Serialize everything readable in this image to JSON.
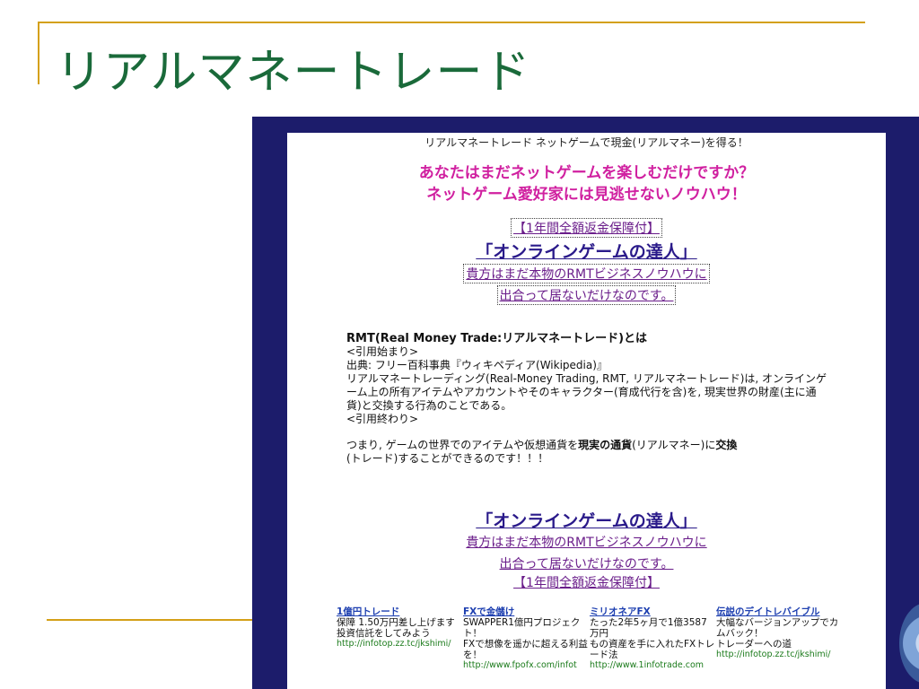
{
  "slide": {
    "title": "リアルマネートレード"
  },
  "page": {
    "top_note": "リアルマネートレード  ネットゲームで現金(リアルマネー)を得る！",
    "headline": [
      "あなたはまだネットゲームを楽しむだけですか？",
      "ネットゲーム愛好家には見逃せないノウハウ！"
    ],
    "guarantee_link": "【1年間全額返金保障付】",
    "master_link": "「オンラインゲームの達人」",
    "business_link": "貴方はまだ本物のRMTビジネスノウハウに",
    "notmet_link": "出合って居ないだけなのです。",
    "rmt_heading": "RMT(Real Money Trade:リアルマネートレード)とは",
    "quote_start": "<引用始まり>",
    "source": "出典: フリー百科事典『ウィキペディア(Wikipedia)』",
    "definition": "リアルマネートレーディング(Real-Money Trading, RMT, リアルマネートレード)は, オンラインゲーム上の所有アイテムやアカウントやそのキャラクター(育成代行を含)を, 現実世界の財産(主に通貨)と交換する行為のことである。",
    "quote_end": "<引用終わり>",
    "summary_pre": "つまり, ゲームの世界でのアイテムや仮想通貨を",
    "summary_bold1": "現実の通貨",
    "summary_mid": "(リアルマネー)に",
    "summary_bold2": "交換",
    "summary_post": "(トレード)することができるのです！！！",
    "master_link2": "「オンラインゲームの達人」",
    "business_link2": "貴方はまだ本物のRMTビジネスノウハウに",
    "notmet_link2": "出合って居ないだけなのです。",
    "guarantee_link2": "【1年間全額返金保障付】"
  },
  "ads": [
    {
      "title": "1億円トレード",
      "text": "保障 1.50万円差し上げます\n投資信託をしてみよう",
      "url": "http://infotop.zz.tc/jkshimi/"
    },
    {
      "title": "FXで金儲け",
      "text": "SWAPPER1億円プロジェクト！\nFXで想像を遥かに超える利益を！",
      "url": "http://www.fpofx.com/infot"
    },
    {
      "title": "ミリオネアFX",
      "text": "たった2年5ヶ月で1億3587万円\nもの資産を手に入れたFXトレード法",
      "url": "http://www.1infotrade.com"
    },
    {
      "title": "伝説のデイトレバイブル",
      "text": "大幅なバージョンアップでカムバック！\nトレーダーへの道",
      "url": "http://infotop.zz.tc/jkshimi/"
    }
  ],
  "colors": {
    "accent_gold": "#d4a017",
    "title_green": "#1a6a3a",
    "frame_navy": "#1c1c6b",
    "headline_pink": "#d020a0"
  }
}
